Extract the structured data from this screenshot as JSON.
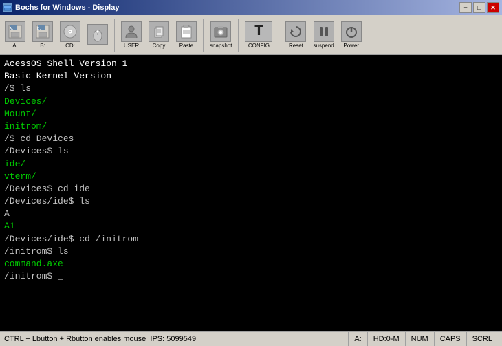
{
  "window": {
    "title": "Bochs for Windows - Display",
    "min_label": "−",
    "max_label": "□",
    "close_label": "✕"
  },
  "toolbar": {
    "buttons": [
      {
        "id": "floppy-a",
        "label": "A:",
        "icon": "💾"
      },
      {
        "id": "floppy-b",
        "label": "B:",
        "icon": "💾"
      },
      {
        "id": "cdrom",
        "label": "CD:",
        "icon": "💿"
      },
      {
        "id": "mouse",
        "label": "",
        "icon": "🖱"
      },
      {
        "id": "user",
        "label": "USER",
        "icon": "👤"
      },
      {
        "id": "copy",
        "label": "Copy",
        "icon": "📋"
      },
      {
        "id": "paste",
        "label": "Paste",
        "icon": "📌"
      },
      {
        "id": "snapshot",
        "label": "snapshot",
        "icon": "📷"
      },
      {
        "id": "config",
        "label": "CONFIG",
        "icon": "T"
      },
      {
        "id": "reset",
        "label": "Reset",
        "icon": "↺"
      },
      {
        "id": "suspend",
        "label": "suspend",
        "icon": "⏸"
      },
      {
        "id": "power",
        "label": "Power",
        "icon": "⏻"
      }
    ]
  },
  "terminal": {
    "lines": [
      {
        "text": "AcessOS Shell Version 1",
        "color": "white"
      },
      {
        "text": "Basic Kernel Version",
        "color": "white"
      },
      {
        "text": "",
        "color": "normal"
      },
      {
        "text": "/$ ls",
        "color": "normal"
      },
      {
        "text": "Devices/",
        "color": "green"
      },
      {
        "text": "Mount/",
        "color": "green"
      },
      {
        "text": "initrom/",
        "color": "green"
      },
      {
        "text": "/$ cd Devices",
        "color": "normal"
      },
      {
        "text": "/Devices$ ls",
        "color": "normal"
      },
      {
        "text": "ide/",
        "color": "green"
      },
      {
        "text": "vterm/",
        "color": "green"
      },
      {
        "text": "/Devices$ cd ide",
        "color": "normal"
      },
      {
        "text": "/Devices/ide$ ls",
        "color": "normal"
      },
      {
        "text": "A",
        "color": "normal"
      },
      {
        "text": "A1",
        "color": "green"
      },
      {
        "text": "/Devices/ide$ cd /initrom",
        "color": "normal"
      },
      {
        "text": "/initrom$ ls",
        "color": "normal"
      },
      {
        "text": "command.axe",
        "color": "green"
      },
      {
        "text": "/initrom$ _",
        "color": "normal"
      }
    ]
  },
  "statusbar": {
    "mouse_info": "CTRL + Lbutton + Rbutton enables mouse",
    "ips_label": "IPS:",
    "ips_value": "5099549",
    "drive_a": "A:",
    "hd": "HD:0-M",
    "num": "NUM",
    "caps": "CAPS",
    "scrl": "SCRL"
  }
}
